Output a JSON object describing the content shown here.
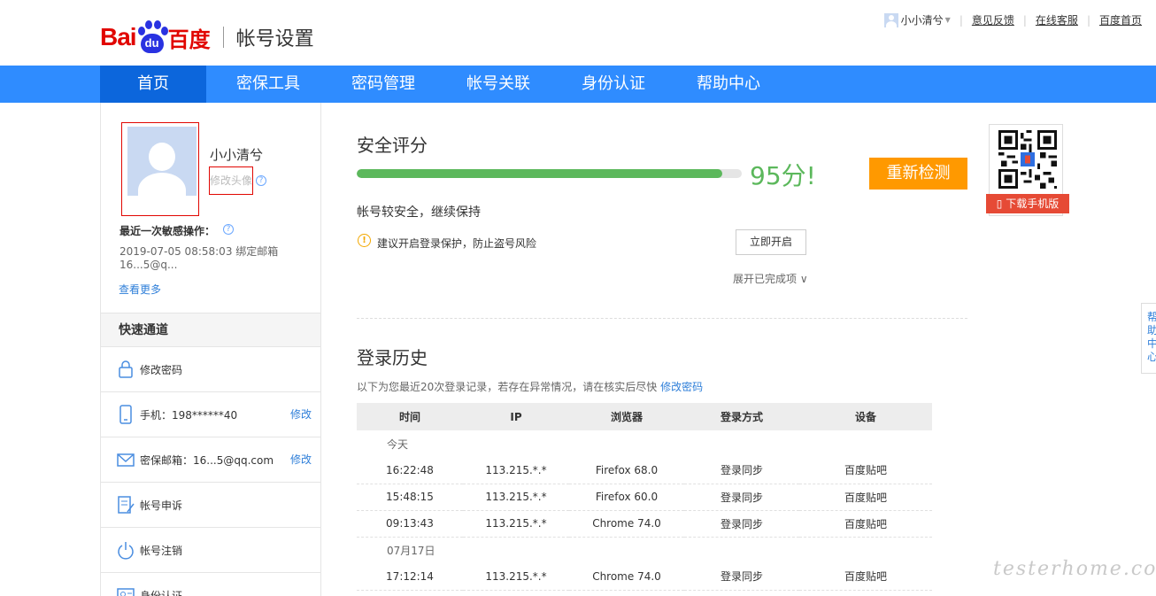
{
  "header": {
    "logo_left": "Bai",
    "logo_paw": "du",
    "logo_right": "百度",
    "title": "帐号设置",
    "username": "小小清兮",
    "links": [
      "意见反馈",
      "在线客服",
      "百度首页"
    ]
  },
  "nav": {
    "items": [
      "首页",
      "密保工具",
      "密码管理",
      "帐号关联",
      "身份认证",
      "帮助中心"
    ]
  },
  "sidebar": {
    "username": "小小清兮",
    "edit_avatar": "修改头像",
    "help_mark": "?",
    "recent_label": "最近一次敏感操作：",
    "recent_info": "2019-07-05 08:58:03   绑定邮箱 16...5@q...",
    "see_more": "查看更多",
    "quick_title": "快速通道",
    "quick_items": [
      {
        "label": "修改密码",
        "action": "",
        "icon": "lock-icon"
      },
      {
        "label": "手机：198******40",
        "action": "修改",
        "icon": "phone-icon"
      },
      {
        "label": "密保邮箱：16...5@qq.com",
        "action": "修改",
        "icon": "mail-icon"
      },
      {
        "label": "帐号申诉",
        "action": "",
        "icon": "document-edit-icon"
      },
      {
        "label": "帐号注销",
        "action": "",
        "icon": "power-icon"
      },
      {
        "label": "身份认证",
        "action": "",
        "icon": "id-card-icon"
      }
    ]
  },
  "security": {
    "title": "安全评分",
    "score": 95,
    "score_text": "95分!",
    "recheck_label": "重新检测",
    "status": "帐号较安全，继续保持",
    "warn_mark": "!",
    "warning": "建议开启登录保护，防止盗号风险",
    "open_label": "立即开启",
    "expand_label": "展开已完成项 ∨"
  },
  "login_history": {
    "title": "登录历史",
    "desc": "以下为您最近20次登录记录，若存在异常情况，请在核实后尽快",
    "desc_link": "修改密码",
    "columns": [
      "时间",
      "IP",
      "浏览器",
      "登录方式",
      "设备"
    ],
    "groups": [
      {
        "date": "今天",
        "rows": [
          [
            "16:22:48",
            "113.215.*.*",
            "Firefox 68.0",
            "登录同步",
            "百度贴吧"
          ],
          [
            "15:48:15",
            "113.215.*.*",
            "Firefox 60.0",
            "登录同步",
            "百度贴吧"
          ],
          [
            "09:13:43",
            "113.215.*.*",
            "Chrome 74.0",
            "登录同步",
            "百度贴吧"
          ]
        ]
      },
      {
        "date": "07月17日",
        "rows": [
          [
            "17:12:14",
            "113.215.*.*",
            "Chrome 74.0",
            "登录同步",
            "百度贴吧"
          ]
        ]
      }
    ]
  },
  "qr": {
    "label": "下载手机版"
  },
  "help_tab": {
    "label": "帮助中心"
  },
  "watermark": "testerhome.com",
  "colors": {
    "nav": "#2f8cff",
    "nav_active": "#0c66dc",
    "score": "#5cb85c",
    "recheck": "#ff9900",
    "link": "#2f7fd9",
    "brand_red": "#e10601"
  }
}
